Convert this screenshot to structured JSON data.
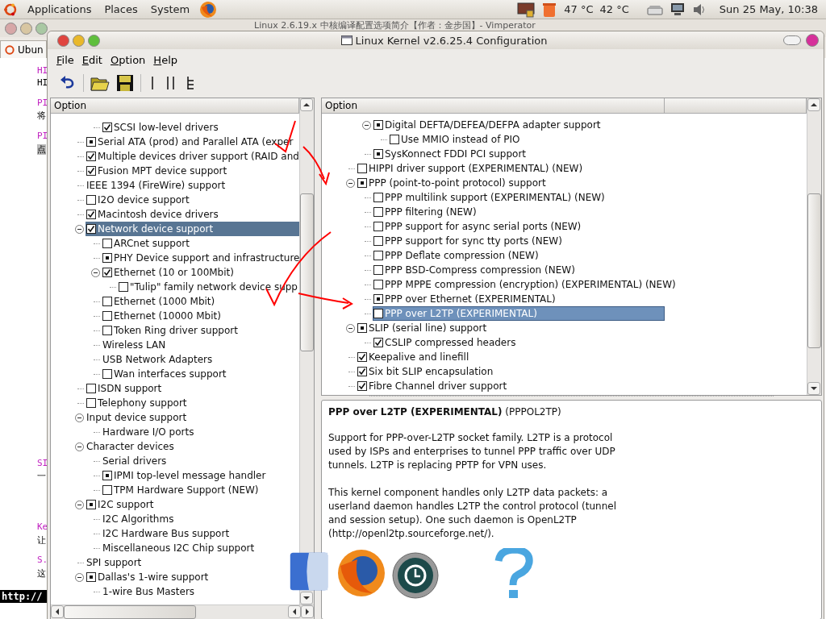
{
  "top_panel": {
    "menus": [
      "Applications",
      "Places",
      "System"
    ],
    "temperatures": [
      "47 °C",
      "42 °C"
    ],
    "clock": "Sun 25 May, 10:38"
  },
  "background": {
    "window_title": "Linux 2.6.19.x 中核编译配置选项简介【作者：金步国】- Vimperator",
    "tab": "Ubun",
    "fragments": [
      {
        "text": "HI",
        "kind": "link"
      },
      {
        "text": "HI",
        "kind": "plain"
      },
      {
        "text": "PI",
        "kind": "link"
      },
      {
        "text": "将",
        "kind": "plain"
      },
      {
        "text": "PI",
        "kind": "link"
      },
      {
        "text": "点",
        "kind": "highlight"
      },
      {
        "text": "SI",
        "kind": "link"
      },
      {
        "text": "一",
        "kind": "plain"
      },
      {
        "text": "Ke",
        "kind": "link"
      },
      {
        "text": "让",
        "kind": "plain"
      },
      {
        "text": "S.",
        "kind": "link"
      },
      {
        "text": "这",
        "kind": "plain"
      }
    ],
    "status": "http://"
  },
  "window": {
    "title": "Linux Kernel v2.6.25.4 Configuration",
    "menu": [
      "File",
      "Edit",
      "Option",
      "Help"
    ]
  },
  "left_tree": {
    "columns": [
      "Option"
    ],
    "items": [
      {
        "children": [
          {
            "label": "SCSI low-level drivers",
            "checked": true,
            "module": false,
            "selected": false
          }
        ]
      },
      {
        "label": "Serial ATA (prod) and Parallel ATA (exper",
        "checked": false,
        "module": true,
        "selected": false
      },
      {
        "label": "Multiple devices driver support (RAID and",
        "checked": true,
        "module": false,
        "selected": false
      },
      {
        "label": "Fusion MPT device support",
        "checked": true,
        "module": false,
        "selected": false
      },
      {
        "label": "IEEE 1394 (FireWire) support",
        "selected": false
      },
      {
        "label": "I2O device support",
        "checked": false,
        "module": false,
        "selected": false
      },
      {
        "label": "Macintosh device drivers",
        "checked": true,
        "module": false,
        "selected": false
      },
      {
        "label": "Network device support",
        "checked": true,
        "module": false,
        "selected": true,
        "expanded": true,
        "children": [
          {
            "label": "ARCnet support",
            "checked": false,
            "module": false,
            "selected": false
          },
          {
            "label": "PHY Device support and infrastructure",
            "checked": false,
            "module": true,
            "selected": false
          },
          {
            "label": "Ethernet (10 or 100Mbit)",
            "checked": true,
            "module": false,
            "selected": false,
            "expanded": true,
            "children": [
              {
                "label": "\"Tulip\" family network device supp",
                "checked": false,
                "module": false,
                "selected": false
              }
            ]
          },
          {
            "label": "Ethernet (1000 Mbit)",
            "checked": false,
            "module": false,
            "selected": false
          },
          {
            "label": "Ethernet (10000 Mbit)",
            "checked": false,
            "module": false,
            "selected": false
          },
          {
            "label": "Token Ring driver support",
            "checked": false,
            "module": false,
            "selected": false
          },
          {
            "label": "Wireless LAN",
            "selected": false
          },
          {
            "label": "USB Network Adapters",
            "selected": false
          },
          {
            "label": "Wan interfaces support",
            "checked": false,
            "module": false,
            "selected": false
          }
        ]
      },
      {
        "label": "ISDN support",
        "checked": false,
        "module": false,
        "selected": false
      },
      {
        "label": "Telephony support",
        "checked": false,
        "module": false,
        "selected": false
      },
      {
        "label": "Input device support",
        "selected": false,
        "expanded": true,
        "children": [
          {
            "label": "Hardware I/O ports",
            "selected": false
          }
        ]
      },
      {
        "label": "Character devices",
        "selected": false,
        "expanded": true,
        "children": [
          {
            "label": "Serial drivers",
            "selected": false
          },
          {
            "label": "IPMI top-level message handler",
            "checked": false,
            "module": true,
            "selected": false
          },
          {
            "label": "TPM Hardware Support (NEW)",
            "checked": false,
            "module": false,
            "selected": false
          }
        ]
      },
      {
        "label": "I2C support",
        "checked": false,
        "module": true,
        "selected": false,
        "expanded": true,
        "children": [
          {
            "label": "I2C Algorithms",
            "selected": false
          },
          {
            "label": "I2C Hardware Bus support",
            "selected": false
          },
          {
            "label": "Miscellaneous I2C Chip support",
            "selected": false
          }
        ]
      },
      {
        "label": "SPI support",
        "selected": false
      },
      {
        "label": "Dallas's 1-wire support",
        "checked": false,
        "module": true,
        "selected": false,
        "expanded": true,
        "children": [
          {
            "label": "1-wire Bus Masters",
            "selected": false
          }
        ]
      }
    ]
  },
  "right_tree": {
    "columns": [
      "Option"
    ],
    "items": [
      {
        "children": [
          {
            "label": "Digital DEFTA/DEFEA/DEFPA adapter support",
            "checked": false,
            "module": true,
            "selected": false,
            "expanded": true,
            "children": [
              {
                "label": "Use MMIO instead of PIO",
                "checked": false,
                "module": false,
                "selected": false
              }
            ]
          },
          {
            "label": "SysKonnect FDDI PCI support",
            "checked": false,
            "module": true,
            "selected": false
          }
        ]
      },
      {
        "label": "HIPPI driver support (EXPERIMENTAL) (NEW)",
        "checked": false,
        "module": false,
        "selected": false
      },
      {
        "label": "PPP (point-to-point protocol) support",
        "checked": false,
        "module": true,
        "selected": false,
        "expanded": true,
        "children": [
          {
            "label": "PPP multilink support (EXPERIMENTAL) (NEW)",
            "checked": false,
            "module": false,
            "selected": false
          },
          {
            "label": "PPP filtering (NEW)",
            "checked": false,
            "module": false,
            "selected": false
          },
          {
            "label": "PPP support for async serial ports (NEW)",
            "checked": false,
            "module": false,
            "selected": false
          },
          {
            "label": "PPP support for sync tty ports (NEW)",
            "checked": false,
            "module": false,
            "selected": false
          },
          {
            "label": "PPP Deflate compression (NEW)",
            "checked": false,
            "module": false,
            "selected": false
          },
          {
            "label": "PPP BSD-Compress compression (NEW)",
            "checked": false,
            "module": false,
            "selected": false
          },
          {
            "label": "PPP MPPE compression (encryption) (EXPERIMENTAL) (NEW)",
            "checked": false,
            "module": false,
            "selected": false
          },
          {
            "label": "PPP over Ethernet (EXPERIMENTAL)",
            "checked": false,
            "module": true,
            "selected": false
          },
          {
            "label": "PPP over L2TP (EXPERIMENTAL)",
            "checked": false,
            "module": false,
            "selected": true
          }
        ]
      },
      {
        "label": "SLIP (serial line) support",
        "checked": false,
        "module": true,
        "selected": false,
        "expanded": true,
        "children": [
          {
            "label": "CSLIP compressed headers",
            "checked": true,
            "module": false,
            "selected": false
          }
        ]
      },
      {
        "label": "Keepalive and linefill",
        "checked": true,
        "module": false,
        "selected": false
      },
      {
        "label": "Six bit SLIP encapsulation",
        "checked": true,
        "module": false,
        "selected": false
      },
      {
        "label": "Fibre Channel driver support",
        "checked": true,
        "module": false,
        "selected": false
      }
    ]
  },
  "help": {
    "heading": "**PPP over L2TP (EXPERIMENTAL)** (PPPOL2TP)",
    "paragraphs": [
      "Support for PPP-over-L2TP socket family. L2TP is a protocol used by ISPs and enterprises to tunnel PPP traffic over UDP tunnels. L2TP is replacing PPTP for VPN uses.",
      "This kernel component handles only L2TP data packets: a userland daemon handles L2TP the control protocol (tunnel and session setup). One such daemon is OpenL2TP (http://openl2tp.sourceforge.net/)."
    ]
  }
}
